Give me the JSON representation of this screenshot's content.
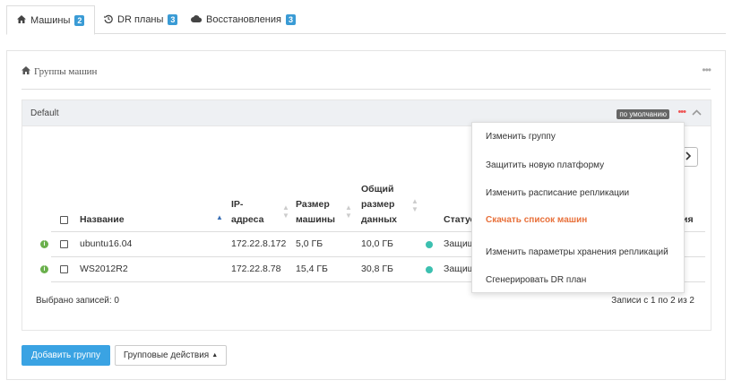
{
  "tabs": [
    {
      "icon": "home-icon",
      "label": "Машины",
      "badge": "2"
    },
    {
      "icon": "history-icon",
      "label": "DR планы",
      "badge": "3"
    },
    {
      "icon": "cloud-icon",
      "label": "Восстановления",
      "badge": "3"
    }
  ],
  "panel": {
    "title": "Группы машин"
  },
  "group": {
    "name": "Default",
    "default_label": "по умолчанию"
  },
  "table": {
    "headers": {
      "name": "Название",
      "ip": [
        "IP-",
        "адреса"
      ],
      "size": [
        "Размер",
        "машины"
      ],
      "total": [
        "Общий",
        "размер",
        "данных"
      ],
      "status": "Статус",
      "last_col_fragment": "ия"
    },
    "rows": [
      {
        "name": "ubuntu16.04",
        "ip": "172.22.8.172",
        "size": "5,0 ГБ",
        "total": "10,0 ГБ",
        "status": "Защищ"
      },
      {
        "name": "WS2012R2",
        "ip": "172.22.8.78",
        "size": "15,4 ГБ",
        "total": "30,8 ГБ",
        "status": "Защищ"
      }
    ],
    "selected_text": "Выбрано записей: 0",
    "pagination_text": "Записи с 1 по 2 из 2"
  },
  "buttons": {
    "add_group": "Добавить группу",
    "group_actions": "Групповые действия"
  },
  "menu": {
    "items": [
      {
        "label": "Изменить группу",
        "accent": false
      },
      {
        "label": "Защитить новую платформу",
        "accent": false
      },
      {
        "label": "Изменить расписание репликации",
        "accent": false
      },
      {
        "label": "Скачать список машин",
        "accent": true
      },
      {
        "label": "Изменить параметры хранения репликаций",
        "accent": false
      },
      {
        "label": "Сгенерировать DR план",
        "accent": false
      }
    ]
  },
  "colors": {
    "accent_blue": "#3aa3e3",
    "badge_blue": "#3a9bd5",
    "menu_accent": "#e8703a",
    "status_dot": "#3cc0b0",
    "info_green": "#6ab04c"
  }
}
